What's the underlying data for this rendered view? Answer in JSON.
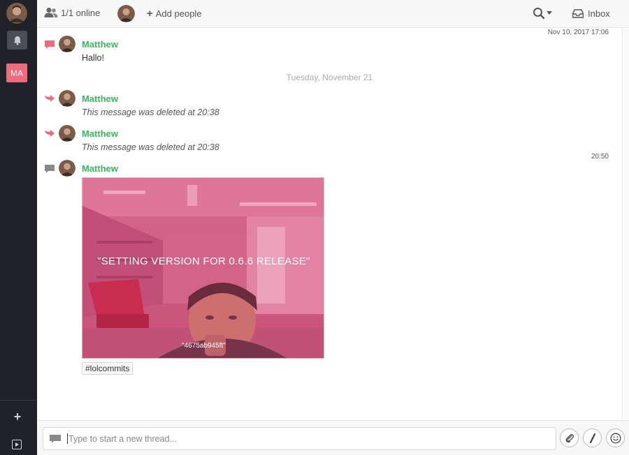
{
  "rail": {
    "workspace_initials": "MA"
  },
  "header": {
    "online_label": "1/1 online",
    "add_people_label": "Add people",
    "inbox_label": "Inbox"
  },
  "timeline": {
    "top_timestamp": "Nov 10, 2017 17:06",
    "date_separator": "Tuesday, November 21",
    "second_timestamp": "20:50",
    "messages": [
      {
        "author": "Matthew",
        "text": "Hallo!"
      },
      {
        "author": "Matthew",
        "text": "This message was deleted at 20:38"
      },
      {
        "author": "Matthew",
        "text": "This message was deleted at 20:38"
      },
      {
        "author": "Matthew",
        "image_caption": "\"SETTING VERSION FOR 0.6.6 RELEASE\"",
        "image_hash": "\"4675ab945ft\"",
        "tag": "#lolcommits"
      }
    ]
  },
  "composer": {
    "placeholder": "Type to start a new thread..."
  },
  "colors": {
    "accent_red": "#ef6a7a",
    "author_green": "#3cb55e",
    "rail_bg": "#1f2226"
  }
}
